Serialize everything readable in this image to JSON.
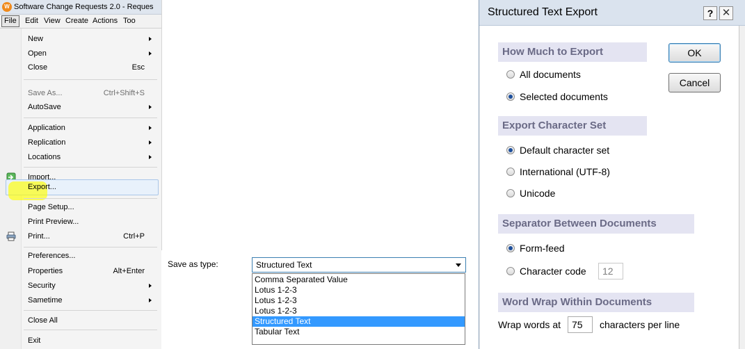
{
  "app": {
    "title": "Software Change Requests 2.0 - Reques",
    "logo_glyph": "W",
    "menubar": [
      "File",
      "Edit",
      "View",
      "Create",
      "Actions",
      "Too"
    ]
  },
  "file_menu": {
    "items": [
      {
        "label": "New",
        "submenu": true
      },
      {
        "label": "Open",
        "submenu": true
      },
      {
        "label": "Close",
        "shortcut": "Esc"
      },
      {
        "label": "Save As...",
        "shortcut": "Ctrl+Shift+S",
        "disabled": true
      },
      {
        "label": "AutoSave",
        "submenu": true
      },
      {
        "label": "Application",
        "submenu": true
      },
      {
        "label": "Replication",
        "submenu": true
      },
      {
        "label": "Locations",
        "submenu": true
      },
      {
        "label": "Import...",
        "icon": "import-icon"
      },
      {
        "label": "Export...",
        "highlighted": true
      },
      {
        "label": "Page Setup..."
      },
      {
        "label": "Print Preview..."
      },
      {
        "label": "Print...",
        "shortcut": "Ctrl+P",
        "icon": "printer-icon"
      },
      {
        "label": "Preferences..."
      },
      {
        "label": "Properties",
        "shortcut": "Alt+Enter"
      },
      {
        "label": "Security",
        "submenu": true
      },
      {
        "label": "Sametime",
        "submenu": true
      },
      {
        "label": "Close All"
      },
      {
        "label": "Exit"
      }
    ]
  },
  "save_as": {
    "label": "Save as type:",
    "selected": "Structured Text",
    "options": [
      "Comma Separated Value",
      "Lotus 1-2-3",
      "Lotus 1-2-3",
      "Lotus 1-2-3",
      "Structured Text",
      "Tabular Text"
    ],
    "selected_index": 4
  },
  "dialog": {
    "title": "Structured Text Export",
    "help": "?",
    "close": "✕",
    "ok": "OK",
    "cancel": "Cancel",
    "how_much": {
      "heading": "How Much to Export",
      "options": [
        "All documents",
        "Selected documents"
      ],
      "selected": 1
    },
    "charset": {
      "heading": "Export Character Set",
      "options": [
        "Default character set",
        "International (UTF-8)",
        "Unicode"
      ],
      "selected": 0
    },
    "separator": {
      "heading": "Separator Between Documents",
      "options": [
        "Form-feed",
        "Character code"
      ],
      "selected": 0,
      "character_code": "12"
    },
    "word_wrap": {
      "heading": "Word Wrap Within Documents",
      "prefix": "Wrap words at",
      "value": "75",
      "suffix": "characters per line"
    }
  },
  "colors": {
    "highlight_marker": "#ffff00",
    "selected_option": "#3399ff",
    "section_header_bg": "#e4e4f2"
  }
}
